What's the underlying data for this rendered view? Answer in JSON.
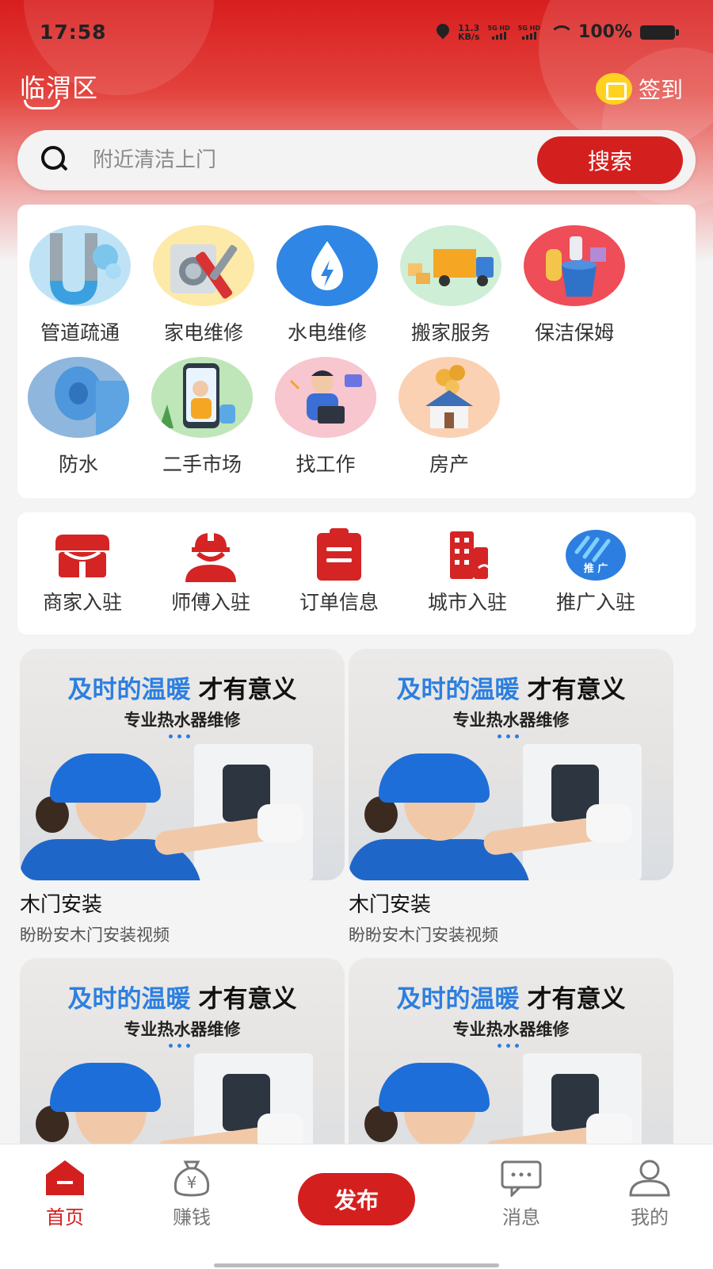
{
  "status_bar": {
    "time": "17:58",
    "net_speed_value": "11.3",
    "net_speed_unit": "KB/s",
    "sim1": "5G HD",
    "sim2": "5G HD",
    "battery": "100%"
  },
  "header": {
    "city": "临渭区",
    "checkin_label": "签到",
    "checkin_icon": "calendar-icon"
  },
  "search": {
    "placeholder": "附近清洁上门",
    "button_label": "搜索"
  },
  "categories": [
    {
      "label": "管道疏通",
      "icon": "pipe-icon"
    },
    {
      "label": "家电维修",
      "icon": "appliance-repair-icon"
    },
    {
      "label": "水电维修",
      "icon": "water-electric-icon"
    },
    {
      "label": "搬家服务",
      "icon": "moving-truck-icon"
    },
    {
      "label": "保洁保姆",
      "icon": "cleaning-bucket-icon"
    },
    {
      "label": "防水",
      "icon": "waterproof-roll-icon"
    },
    {
      "label": "二手市场",
      "icon": "secondhand-market-icon"
    },
    {
      "label": "找工作",
      "icon": "job-search-icon"
    },
    {
      "label": "房产",
      "icon": "house-coins-icon"
    }
  ],
  "entries": [
    {
      "label": "商家入驻",
      "icon": "store-icon"
    },
    {
      "label": "师傅入驻",
      "icon": "worker-helmet-icon"
    },
    {
      "label": "订单信息",
      "icon": "clipboard-icon"
    },
    {
      "label": "城市入驻",
      "icon": "city-building-icon"
    },
    {
      "label": "推广入驻",
      "icon": "promote-icon",
      "badge": "推 广"
    }
  ],
  "feed": [
    {
      "headline_blue": "及时的温暖",
      "headline_dark": "才有意义",
      "subline": "专业热水器维修",
      "title": "木门安装",
      "desc": "盼盼安木门安装视频"
    },
    {
      "headline_blue": "及时的温暖",
      "headline_dark": "才有意义",
      "subline": "专业热水器维修",
      "title": "木门安装",
      "desc": "盼盼安木门安装视频"
    },
    {
      "headline_blue": "及时的温暖",
      "headline_dark": "才有意义",
      "subline": "专业热水器维修",
      "title": "",
      "desc": ""
    },
    {
      "headline_blue": "及时的温暖",
      "headline_dark": "才有意义",
      "subline": "专业热水器维修",
      "title": "",
      "desc": ""
    }
  ],
  "tabbar": {
    "home": "首页",
    "earn": "赚钱",
    "publish": "发布",
    "messages": "消息",
    "mine": "我的",
    "earn_icon_glyph": "¥"
  },
  "colors": {
    "brand_red": "#d41f1f",
    "accent_blue": "#2c7fe0",
    "checkin_yellow": "#ffd21f"
  }
}
